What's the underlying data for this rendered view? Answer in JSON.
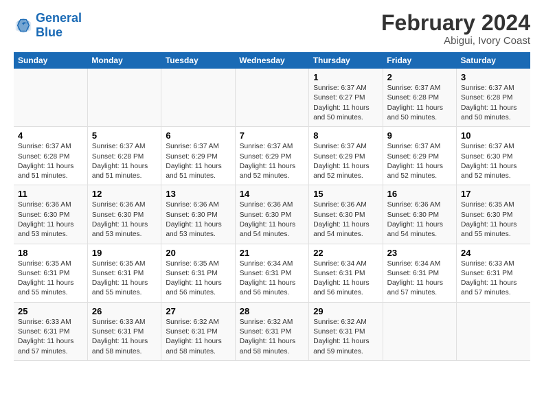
{
  "logo": {
    "line1": "General",
    "line2": "Blue"
  },
  "title": "February 2024",
  "subtitle": "Abigui, Ivory Coast",
  "headers": [
    "Sunday",
    "Monday",
    "Tuesday",
    "Wednesday",
    "Thursday",
    "Friday",
    "Saturday"
  ],
  "weeks": [
    [
      {
        "day": "",
        "text": ""
      },
      {
        "day": "",
        "text": ""
      },
      {
        "day": "",
        "text": ""
      },
      {
        "day": "",
        "text": ""
      },
      {
        "day": "1",
        "text": "Sunrise: 6:37 AM\nSunset: 6:27 PM\nDaylight: 11 hours\nand 50 minutes."
      },
      {
        "day": "2",
        "text": "Sunrise: 6:37 AM\nSunset: 6:28 PM\nDaylight: 11 hours\nand 50 minutes."
      },
      {
        "day": "3",
        "text": "Sunrise: 6:37 AM\nSunset: 6:28 PM\nDaylight: 11 hours\nand 50 minutes."
      }
    ],
    [
      {
        "day": "4",
        "text": "Sunrise: 6:37 AM\nSunset: 6:28 PM\nDaylight: 11 hours\nand 51 minutes."
      },
      {
        "day": "5",
        "text": "Sunrise: 6:37 AM\nSunset: 6:28 PM\nDaylight: 11 hours\nand 51 minutes."
      },
      {
        "day": "6",
        "text": "Sunrise: 6:37 AM\nSunset: 6:29 PM\nDaylight: 11 hours\nand 51 minutes."
      },
      {
        "day": "7",
        "text": "Sunrise: 6:37 AM\nSunset: 6:29 PM\nDaylight: 11 hours\nand 52 minutes."
      },
      {
        "day": "8",
        "text": "Sunrise: 6:37 AM\nSunset: 6:29 PM\nDaylight: 11 hours\nand 52 minutes."
      },
      {
        "day": "9",
        "text": "Sunrise: 6:37 AM\nSunset: 6:29 PM\nDaylight: 11 hours\nand 52 minutes."
      },
      {
        "day": "10",
        "text": "Sunrise: 6:37 AM\nSunset: 6:30 PM\nDaylight: 11 hours\nand 52 minutes."
      }
    ],
    [
      {
        "day": "11",
        "text": "Sunrise: 6:36 AM\nSunset: 6:30 PM\nDaylight: 11 hours\nand 53 minutes."
      },
      {
        "day": "12",
        "text": "Sunrise: 6:36 AM\nSunset: 6:30 PM\nDaylight: 11 hours\nand 53 minutes."
      },
      {
        "day": "13",
        "text": "Sunrise: 6:36 AM\nSunset: 6:30 PM\nDaylight: 11 hours\nand 53 minutes."
      },
      {
        "day": "14",
        "text": "Sunrise: 6:36 AM\nSunset: 6:30 PM\nDaylight: 11 hours\nand 54 minutes."
      },
      {
        "day": "15",
        "text": "Sunrise: 6:36 AM\nSunset: 6:30 PM\nDaylight: 11 hours\nand 54 minutes."
      },
      {
        "day": "16",
        "text": "Sunrise: 6:36 AM\nSunset: 6:30 PM\nDaylight: 11 hours\nand 54 minutes."
      },
      {
        "day": "17",
        "text": "Sunrise: 6:35 AM\nSunset: 6:30 PM\nDaylight: 11 hours\nand 55 minutes."
      }
    ],
    [
      {
        "day": "18",
        "text": "Sunrise: 6:35 AM\nSunset: 6:31 PM\nDaylight: 11 hours\nand 55 minutes."
      },
      {
        "day": "19",
        "text": "Sunrise: 6:35 AM\nSunset: 6:31 PM\nDaylight: 11 hours\nand 55 minutes."
      },
      {
        "day": "20",
        "text": "Sunrise: 6:35 AM\nSunset: 6:31 PM\nDaylight: 11 hours\nand 56 minutes."
      },
      {
        "day": "21",
        "text": "Sunrise: 6:34 AM\nSunset: 6:31 PM\nDaylight: 11 hours\nand 56 minutes."
      },
      {
        "day": "22",
        "text": "Sunrise: 6:34 AM\nSunset: 6:31 PM\nDaylight: 11 hours\nand 56 minutes."
      },
      {
        "day": "23",
        "text": "Sunrise: 6:34 AM\nSunset: 6:31 PM\nDaylight: 11 hours\nand 57 minutes."
      },
      {
        "day": "24",
        "text": "Sunrise: 6:33 AM\nSunset: 6:31 PM\nDaylight: 11 hours\nand 57 minutes."
      }
    ],
    [
      {
        "day": "25",
        "text": "Sunrise: 6:33 AM\nSunset: 6:31 PM\nDaylight: 11 hours\nand 57 minutes."
      },
      {
        "day": "26",
        "text": "Sunrise: 6:33 AM\nSunset: 6:31 PM\nDaylight: 11 hours\nand 58 minutes."
      },
      {
        "day": "27",
        "text": "Sunrise: 6:32 AM\nSunset: 6:31 PM\nDaylight: 11 hours\nand 58 minutes."
      },
      {
        "day": "28",
        "text": "Sunrise: 6:32 AM\nSunset: 6:31 PM\nDaylight: 11 hours\nand 58 minutes."
      },
      {
        "day": "29",
        "text": "Sunrise: 6:32 AM\nSunset: 6:31 PM\nDaylight: 11 hours\nand 59 minutes."
      },
      {
        "day": "",
        "text": ""
      },
      {
        "day": "",
        "text": ""
      }
    ]
  ]
}
